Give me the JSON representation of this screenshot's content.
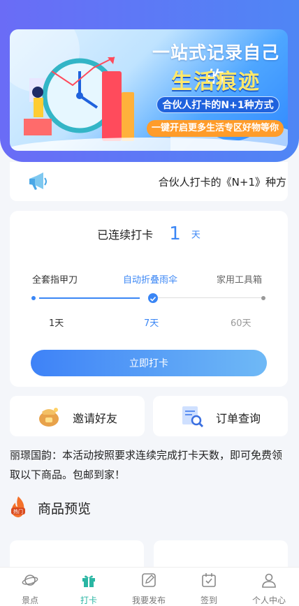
{
  "banner": {
    "title_line1": "一站式记录自己的",
    "title_line2": "生活痕迹",
    "pill1": "合伙人打卡的N+1种方式",
    "pill2": "一键开启更多生活专区好物等你"
  },
  "notice": {
    "text": "合伙人打卡的《N+1》种方"
  },
  "checkin": {
    "label": "已连续打卡",
    "count": "1",
    "unit": "天",
    "rewards": [
      "全套指甲刀",
      "自动折叠雨伞",
      "家用工具箱"
    ],
    "days": [
      "1天",
      "7天",
      "60天"
    ],
    "button": "立即打卡",
    "colors": {
      "accent": "#3a86f5",
      "inactive": "#999999"
    }
  },
  "quick_actions": {
    "invite": "邀请好友",
    "orders": "订单查询"
  },
  "description": "丽璟国韵：本活动按照要求连续完成打卡天数，即可免费领取以下商品。包邮到家！",
  "section": {
    "badge": "热门",
    "title": "商品预览"
  },
  "tabbar": {
    "items": [
      "景点",
      "打卡",
      "我要发布",
      "签到",
      "个人中心"
    ],
    "active_index": 1,
    "active_color": "#2ab6a3"
  }
}
